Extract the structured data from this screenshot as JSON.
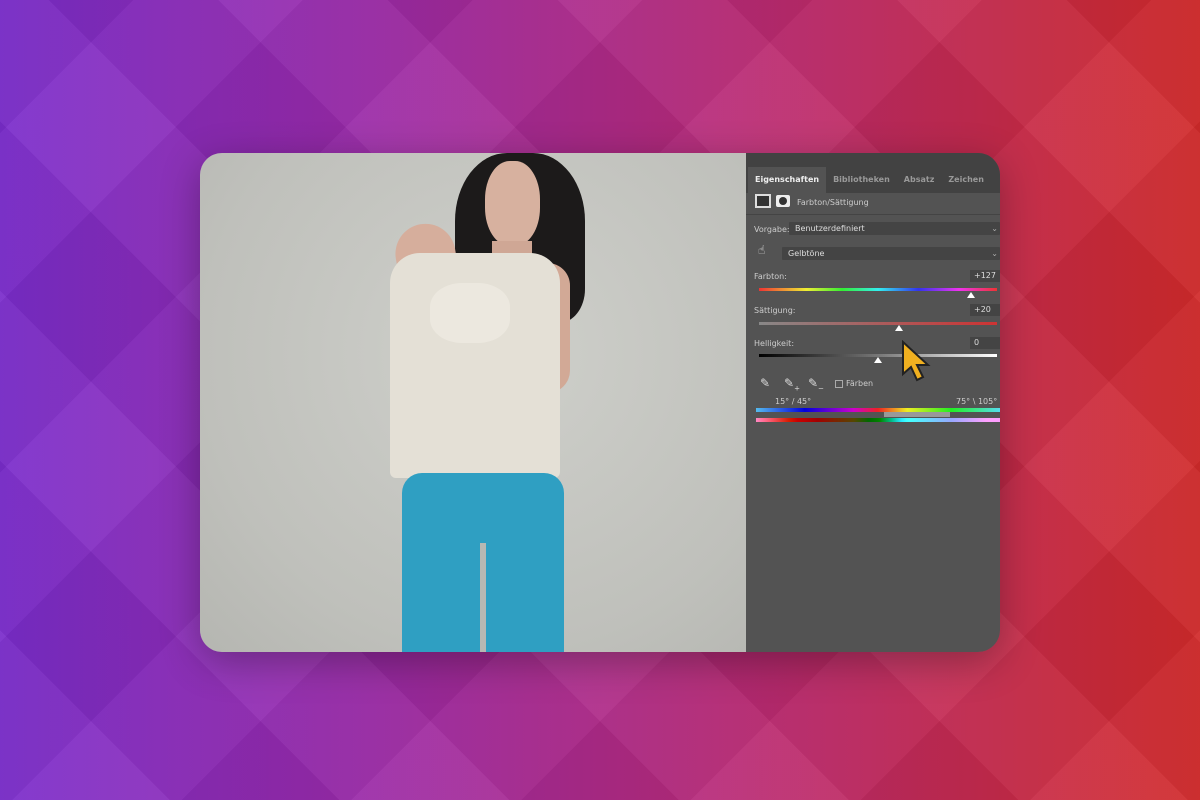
{
  "panel": {
    "tabs": [
      {
        "label": "Eigenschaften",
        "active": true
      },
      {
        "label": "Bibliotheken"
      },
      {
        "label": "Absatz"
      },
      {
        "label": "Zeichen"
      }
    ],
    "adjustment_title": "Farbton/Sättigung",
    "preset_label": "Vorgabe:",
    "preset_value": "Benutzerdefiniert",
    "channel_value": "Gelbtöne",
    "hue": {
      "label": "Farbton:",
      "value": "+127",
      "fraction": 0.89
    },
    "saturation": {
      "label": "Sättigung:",
      "value": "+20",
      "fraction": 0.59
    },
    "lightness": {
      "label": "Helligkeit:",
      "value": "0",
      "fraction": 0.5
    },
    "colorize_label": "Färben",
    "range_left": "15° / 45°",
    "range_right": "75° \\ 105°"
  }
}
